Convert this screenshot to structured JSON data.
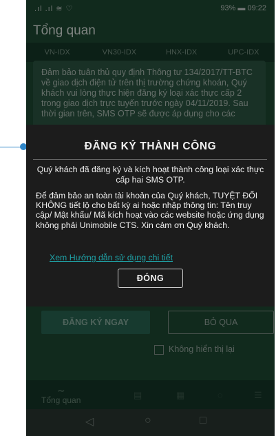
{
  "status_bar": {
    "signal": ".ıl .ıl ≋ ♡",
    "battery": "93%",
    "time": "09:22"
  },
  "appbar": {
    "title": "Tổng quan"
  },
  "tabs": [
    "VN-IDX",
    "VN30-IDX",
    "HNX-IDX",
    "UPC-IDX"
  ],
  "notice": {
    "text": "Đảm bảo tuân thủ quy định Thông tư 134/2017/TT-BTC về giao dịch điện tử trên thị trường chứng khoán, Quý khách vui lòng thực hiện đăng ký loại xác thực cấp 2 trong giao dịch trực tuyến trước ngày 04/11/2019. Sau thời gian trên, SMS OTP sẽ được áp dụng cho các"
  },
  "dialog": {
    "title": "ĐĂNG KÝ THÀNH CÔNG",
    "message": "Quý khách đã đăng ký và kích hoạt thành công loại xác thực cấp hai SMS OTP.",
    "warning": "Để đảm bảo an toàn tài khoản của Quý khách, TUYỆT ĐỐI KHÔNG tiết lộ cho bất kỳ ai hoặc nhập thông tin: Tên truy cập/ Mật khẩu/ Mã kích hoạt vào các website hoặc ứng dụng không phải Unimobile CTS. Xin cảm ơn Quý khách.",
    "link": "Xem Hướng dẫn sử dụng chi tiết",
    "close_label": "ĐÓNG"
  },
  "register_label": "ĐĂNG KÝ NGAY",
  "skip_label": "BỎ QUA",
  "dont_show_label": "Không hiển thị lại",
  "bottom_nav": {
    "home_label": "Tổng quan"
  }
}
